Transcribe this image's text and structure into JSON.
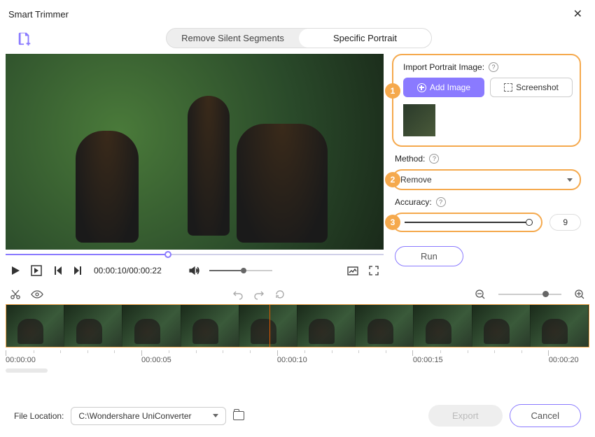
{
  "window": {
    "title": "Smart Trimmer"
  },
  "tabs": {
    "remove_silent": "Remove Silent Segments",
    "specific_portrait": "Specific Portrait",
    "active": "specific_portrait"
  },
  "panel": {
    "import_label": "Import Portrait Image:",
    "add_image": "Add Image",
    "screenshot": "Screenshot",
    "method_label": "Method:",
    "method_value": "Remove",
    "accuracy_label": "Accuracy:",
    "accuracy_value": "9",
    "run": "Run"
  },
  "player": {
    "current": "00:00:10",
    "duration": "00:00:22"
  },
  "ruler": [
    "00:00:00",
    "00:00:05",
    "00:00:10",
    "00:00:15",
    "00:00:20"
  ],
  "footer": {
    "file_location_label": "File Location:",
    "file_location_value": "C:\\Wondershare UniConverter",
    "export": "Export",
    "cancel": "Cancel"
  },
  "steps": {
    "s1": "1",
    "s2": "2",
    "s3": "3"
  }
}
